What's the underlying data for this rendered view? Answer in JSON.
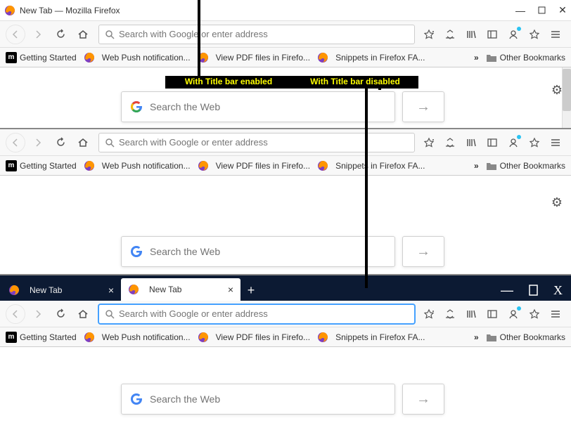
{
  "window_title": "New Tab — Mozilla Firefox",
  "url_placeholder": "Search with Google or enter address",
  "search_placeholder": "Search the Web",
  "labels": {
    "left": "With Title bar enabled",
    "right": "With Title bar disabled"
  },
  "bookmarks": {
    "items": [
      {
        "icon": "m",
        "label": "Getting Started"
      },
      {
        "icon": "ff",
        "label": "Web Push notification..."
      },
      {
        "icon": "ff",
        "label": "View PDF files in Firefo..."
      },
      {
        "icon": "ff",
        "label": "Snippets in Firefox FA..."
      }
    ],
    "overflow": "»",
    "folder_label": "Other Bookmarks"
  },
  "tabs": [
    {
      "label": "New Tab",
      "active": false
    },
    {
      "label": "New Tab",
      "active": true
    }
  ]
}
